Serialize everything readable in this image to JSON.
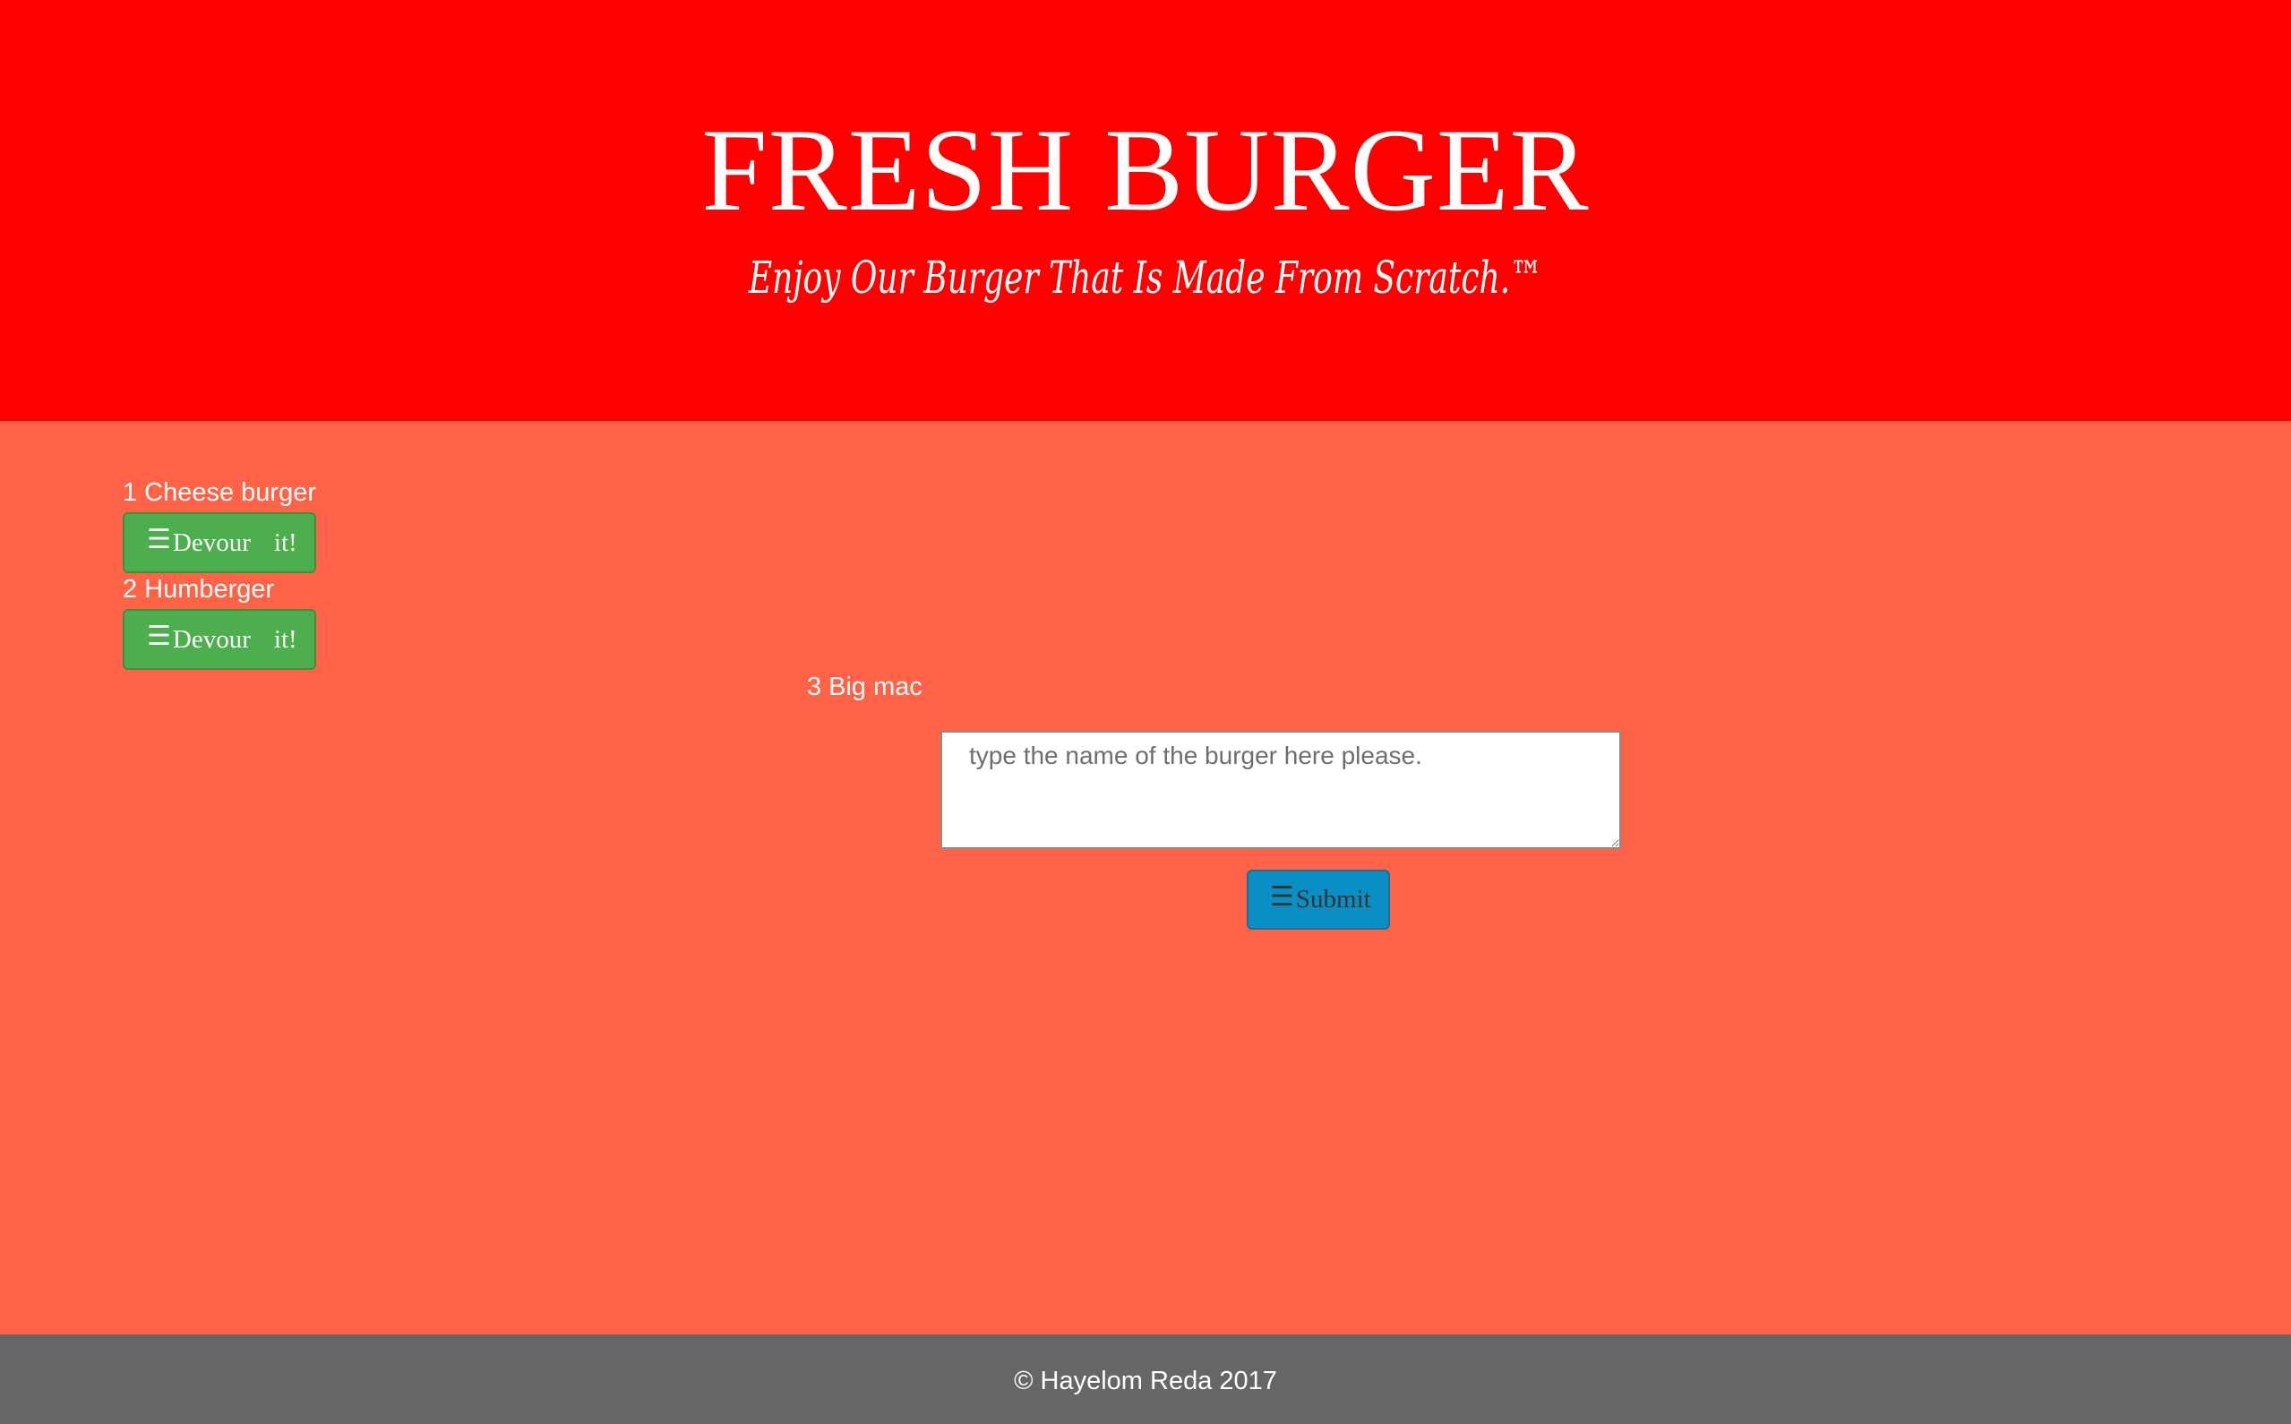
{
  "header": {
    "title": "FRESH BURGER",
    "tagline": "Enjoy Our Burger That Is Made From Scratch.™"
  },
  "burgers_to_devour": [
    {
      "id": "1",
      "name": "Cheese burger",
      "button_label": "Devour",
      "button_label_2": "it!",
      "button_icon": "menu-icon"
    },
    {
      "id": "2",
      "name": "Humberger",
      "button_label": "Devour",
      "button_label_2": "it!",
      "button_icon": "menu-icon"
    }
  ],
  "devoured_burgers": [
    {
      "id": "3",
      "name": "Big mac"
    }
  ],
  "form": {
    "input_placeholder": "type the name of the burger here please.",
    "input_value": "",
    "submit_label": "Submit",
    "submit_icon": "menu-icon"
  },
  "footer": {
    "text": "© Hayelom Reda 2017"
  },
  "colors": {
    "header_bg": "#ff0000",
    "page_bg": "#ff6347",
    "devour_button": "#4cae4c",
    "submit_button": "#0a8fc4",
    "footer_bg": "#666666"
  }
}
